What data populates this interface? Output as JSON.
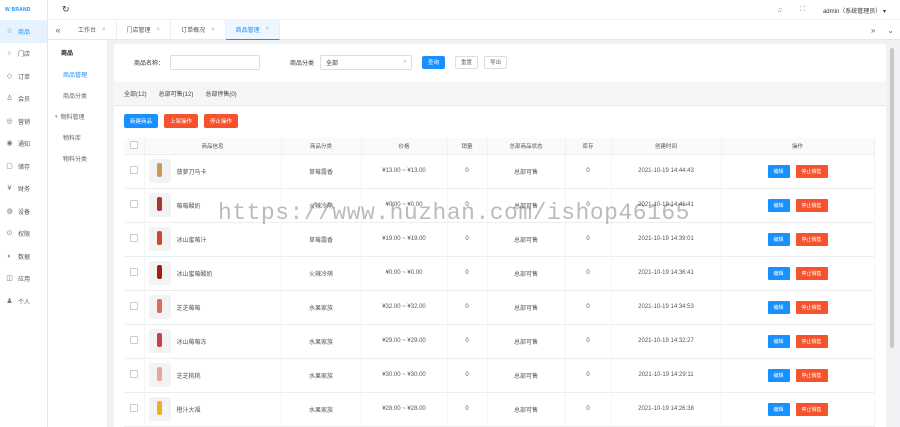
{
  "logo": "W BRAND",
  "nav": [
    {
      "label": "商品",
      "icon": "shop-icon",
      "glyph": "☆",
      "active": true
    },
    {
      "label": "门店",
      "icon": "store-icon",
      "glyph": "○"
    },
    {
      "label": "订单",
      "icon": "order-icon",
      "glyph": "◇"
    },
    {
      "label": "会员",
      "icon": "member-icon",
      "glyph": "♙"
    },
    {
      "label": "营销",
      "icon": "marketing-icon",
      "glyph": "◎"
    },
    {
      "label": "通知",
      "icon": "notify-icon",
      "glyph": "◉"
    },
    {
      "label": "储存",
      "icon": "storage-icon",
      "glyph": "▢"
    },
    {
      "label": "财务",
      "icon": "finance-icon",
      "glyph": "¥"
    },
    {
      "label": "设备",
      "icon": "device-icon",
      "glyph": "◍"
    },
    {
      "label": "权限",
      "icon": "permission-icon",
      "glyph": "⊙"
    },
    {
      "label": "数据",
      "icon": "data-icon",
      "glyph": "◐"
    },
    {
      "label": "应用",
      "icon": "app-icon",
      "glyph": "◫"
    },
    {
      "label": "个人",
      "icon": "user-icon",
      "glyph": "♟"
    }
  ],
  "subnav": {
    "title": "商品",
    "items": [
      {
        "label": "商品管理",
        "active": true
      },
      {
        "label": "商品分类"
      },
      {
        "label": "物料管理",
        "caret": "▾"
      },
      {
        "label": "物料库"
      },
      {
        "label": "物料分类"
      }
    ]
  },
  "header": {
    "user": "admin（系统管理员）",
    "user_caret": "▾"
  },
  "tabs": [
    {
      "label": "工作台"
    },
    {
      "label": "门店管理"
    },
    {
      "label": "订单概况"
    },
    {
      "label": "商品管理",
      "active": true
    }
  ],
  "filter": {
    "name_label": "商品名称：",
    "name_placeholder": "",
    "category_label": "商品分类",
    "category_value": "全部",
    "search_btn": "查询",
    "reset_btn": "重置",
    "export_btn": "导出"
  },
  "subtabs": [
    "全部(12)",
    "总部可售(12)",
    "总部停售(0)"
  ],
  "actions": {
    "add": "新建商品",
    "on_sale": "上架操作",
    "stop_sale": "停止操作"
  },
  "table": {
    "columns": [
      "商品信息",
      "商品分类",
      "价格",
      "销量",
      "总部商品状态",
      "库存",
      "创建时间",
      "操作"
    ],
    "edit_label": "编辑",
    "stop_label": "停止销售",
    "rows": [
      {
        "name": "菠萝刀马卡",
        "category": "草莓露香",
        "price": "¥13.00 ~ ¥13.00",
        "sales": "0",
        "status": "总部可售",
        "stock": "0",
        "created": "2021-10-19 14:44:43",
        "color": "#c79a5a"
      },
      {
        "name": "莓莓酸奶",
        "category": "火辣冷萌",
        "price": "¥0.00 ~ ¥0.00",
        "sales": "0",
        "status": "总部可售",
        "stock": "0",
        "created": "2021-10-19 14:41:41",
        "color": "#b13030"
      },
      {
        "name": "冰山蜜莓汁",
        "category": "草莓露香",
        "price": "¥19.00 ~ ¥19.00",
        "sales": "0",
        "status": "总部可售",
        "stock": "0",
        "created": "2021-10-19 14:39:01",
        "color": "#c9473b"
      },
      {
        "name": "冰山蜜莓酸奶",
        "category": "火辣冷萌",
        "price": "¥0.00 ~ ¥0.00",
        "sales": "0",
        "status": "总部可售",
        "stock": "0",
        "created": "2021-10-19 14:36:41",
        "color": "#a11d1d"
      },
      {
        "name": "芝芝莓莓",
        "category": "水果家族",
        "price": "¥32.00 ~ ¥32.00",
        "sales": "0",
        "status": "总部可售",
        "stock": "0",
        "created": "2021-10-19 14:34:53",
        "color": "#d96c5a"
      },
      {
        "name": "冰山莓莓冻",
        "category": "水果家族",
        "price": "¥29.00 ~ ¥29.00",
        "sales": "0",
        "status": "总部可售",
        "stock": "0",
        "created": "2021-10-19 14:32:27",
        "color": "#c8414a"
      },
      {
        "name": "芝芝桃桃",
        "category": "水果家族",
        "price": "¥30.00 ~ ¥30.00",
        "sales": "0",
        "status": "总部可售",
        "stock": "0",
        "created": "2021-10-19 14:29:11",
        "color": "#e4a79a"
      },
      {
        "name": "橙汁大福",
        "category": "水果家族",
        "price": "¥28.00 ~ ¥28.00",
        "sales": "0",
        "status": "总部可售",
        "stock": "0",
        "created": "2021-10-19 14:26:38",
        "color": "#e7b12b"
      }
    ]
  },
  "watermark": "https://www.huzhan.com/ishop46165",
  "colors": {
    "primary": "#1890ff",
    "danger": "#f5522d"
  }
}
